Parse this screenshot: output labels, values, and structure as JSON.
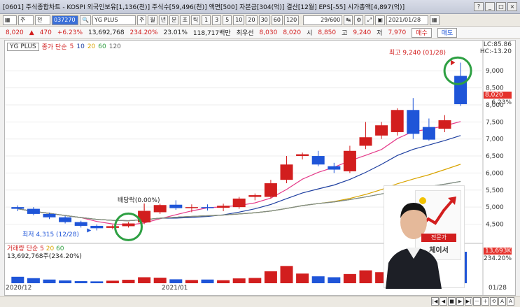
{
  "window": {
    "title": "[0601] 주식종합차트 - KOSPI 외국인보유[1,136(천)] 주식수[59,496(천)] 액면[500] 자본금[304(억)] 결산[12월] EPS[-55] 시가총액[4,897(억)]",
    "buttons": [
      "?",
      "_",
      "□",
      "×"
    ]
  },
  "toolbar": {
    "period_select": "주",
    "market_select": "전",
    "code": "037270",
    "stock_select": "YG PLUS",
    "tabs": [
      "주",
      "월",
      "년",
      "분",
      "초",
      "틱"
    ],
    "intervals": [
      "1",
      "3",
      "5",
      "10",
      "20",
      "30",
      "60",
      "120"
    ],
    "count": "29/600",
    "date": "2021/01/28"
  },
  "quote": {
    "price": "8,020",
    "change": "470",
    "change_pct": "+6.23%",
    "volume": "13,692,768",
    "volume_ratio": "234.20%",
    "turnover": "23.01%",
    "amount": "118,717백만",
    "best_label": "최우선",
    "best_ask": "8,030",
    "best_bid": "8,020",
    "open_label": "시",
    "open": "8,850",
    "high_label": "고",
    "high": "9,240",
    "low_label": "저",
    "low": "7,970",
    "buy_label": "매수",
    "sell_label": "매도"
  },
  "legend": {
    "name": "YG PLUS",
    "ma_label": "종가 단순",
    "ma_periods": [
      "5",
      "10",
      "20",
      "60",
      "120"
    ]
  },
  "sub_legend": {
    "label": "거래량 단순",
    "periods": [
      "5",
      "20",
      "60"
    ],
    "value": "13,692,768주(234.20%)"
  },
  "right_axis": {
    "lc": "LC:85.86",
    "hc": "HC:-13.20",
    "price_tag": "8,020",
    "pct_tag": "6.23%",
    "vol_tag": "13,693K",
    "vol_pct": "234.20%"
  },
  "annotations": {
    "high_label": "최고 9,240 (01/28)",
    "low_label": "최저 4,315 (12/28)",
    "dividend_label": "배당락(0.00%)"
  },
  "promo": {
    "badge": "전문가",
    "name": "체이서"
  },
  "colors": {
    "up": "#d21e1e",
    "down": "#1f55d8",
    "highlight": "#2ea043"
  },
  "chart_data": {
    "type": "candlestick",
    "x_labels": [
      "2020/12",
      "2021/01",
      "01/28"
    ],
    "y_ticks": [
      4500,
      5000,
      5500,
      6000,
      6500,
      7000,
      7500,
      8000,
      8500,
      9000
    ],
    "ylim": [
      4100,
      9600
    ],
    "candles": [
      {
        "o": 5000,
        "h": 5050,
        "l": 4880,
        "c": 4950
      },
      {
        "o": 4950,
        "h": 5000,
        "l": 4760,
        "c": 4800
      },
      {
        "o": 4800,
        "h": 4840,
        "l": 4650,
        "c": 4700
      },
      {
        "o": 4700,
        "h": 4740,
        "l": 4520,
        "c": 4560
      },
      {
        "o": 4560,
        "h": 4600,
        "l": 4400,
        "c": 4450
      },
      {
        "o": 4450,
        "h": 4490,
        "l": 4315,
        "c": 4380
      },
      {
        "o": 4390,
        "h": 4480,
        "l": 4350,
        "c": 4440
      },
      {
        "o": 4440,
        "h": 4560,
        "l": 4400,
        "c": 4520
      },
      {
        "o": 4550,
        "h": 4950,
        "l": 4500,
        "c": 4890
      },
      {
        "o": 4850,
        "h": 5100,
        "l": 4800,
        "c": 5060
      },
      {
        "o": 5070,
        "h": 5200,
        "l": 4920,
        "c": 4970
      },
      {
        "o": 4970,
        "h": 5080,
        "l": 4850,
        "c": 5000
      },
      {
        "o": 5000,
        "h": 5080,
        "l": 4900,
        "c": 4980
      },
      {
        "o": 4980,
        "h": 5100,
        "l": 4880,
        "c": 5040
      },
      {
        "o": 5000,
        "h": 5300,
        "l": 4950,
        "c": 5250
      },
      {
        "o": 5300,
        "h": 5400,
        "l": 5200,
        "c": 5350
      },
      {
        "o": 5300,
        "h": 5800,
        "l": 5250,
        "c": 5700
      },
      {
        "o": 5800,
        "h": 6500,
        "l": 5700,
        "c": 6250
      },
      {
        "o": 6500,
        "h": 6600,
        "l": 6400,
        "c": 6550
      },
      {
        "o": 6500,
        "h": 6650,
        "l": 6200,
        "c": 6250
      },
      {
        "o": 6200,
        "h": 6300,
        "l": 6000,
        "c": 6100
      },
      {
        "o": 6050,
        "h": 6800,
        "l": 6000,
        "c": 6650
      },
      {
        "o": 6800,
        "h": 7500,
        "l": 6700,
        "c": 7050
      },
      {
        "o": 7100,
        "h": 7500,
        "l": 7000,
        "c": 7400
      },
      {
        "o": 7200,
        "h": 7900,
        "l": 7100,
        "c": 7850
      },
      {
        "o": 7850,
        "h": 8200,
        "l": 7000,
        "c": 7150
      },
      {
        "o": 7350,
        "h": 7600,
        "l": 6950,
        "c": 6980
      },
      {
        "o": 7300,
        "h": 7700,
        "l": 7200,
        "c": 7550
      },
      {
        "o": 8850,
        "h": 9240,
        "l": 7970,
        "c": 8020
      }
    ],
    "volume": [
      280,
      220,
      160,
      120,
      90,
      80,
      110,
      150,
      260,
      240,
      170,
      140,
      160,
      130,
      210,
      230,
      520,
      750,
      420,
      300,
      260,
      400,
      560,
      480,
      600,
      560,
      480,
      520,
      1369
    ]
  }
}
